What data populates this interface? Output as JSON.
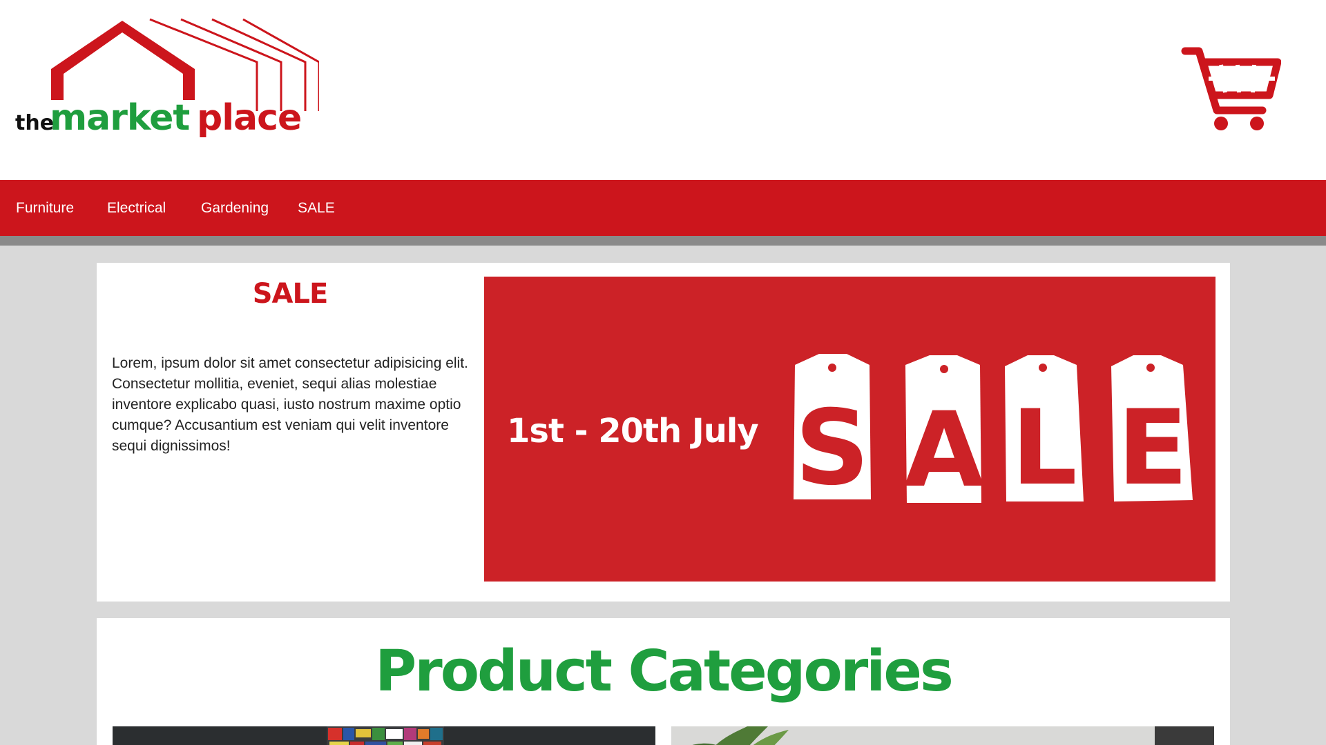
{
  "brand": {
    "logo_text_the": "the",
    "logo_text_market": "market",
    "logo_text_place": "place",
    "colors": {
      "red": "#cc151c",
      "green": "#1f9e3e",
      "black": "#111111"
    }
  },
  "header": {
    "cart_icon": "shopping-cart-icon"
  },
  "nav": {
    "items": [
      {
        "label": "Furniture"
      },
      {
        "label": "Electrical"
      },
      {
        "label": "Gardening"
      },
      {
        "label": "SALE"
      }
    ]
  },
  "sale_section": {
    "heading": "SALE",
    "body": "Lorem, ipsum dolor sit amet consectetur adipisicing elit. Consectetur mollitia, eveniet, sequi alias molestiae inventore explicabo quasi, iusto nostrum maxime optio cumque? Accusantium est veniam qui velit inventore sequi dignissimos!",
    "banner": {
      "dates": "1st - 20th July",
      "tags": [
        "S",
        "A",
        "L",
        "E"
      ]
    }
  },
  "categories_section": {
    "title": "Product Categories"
  }
}
